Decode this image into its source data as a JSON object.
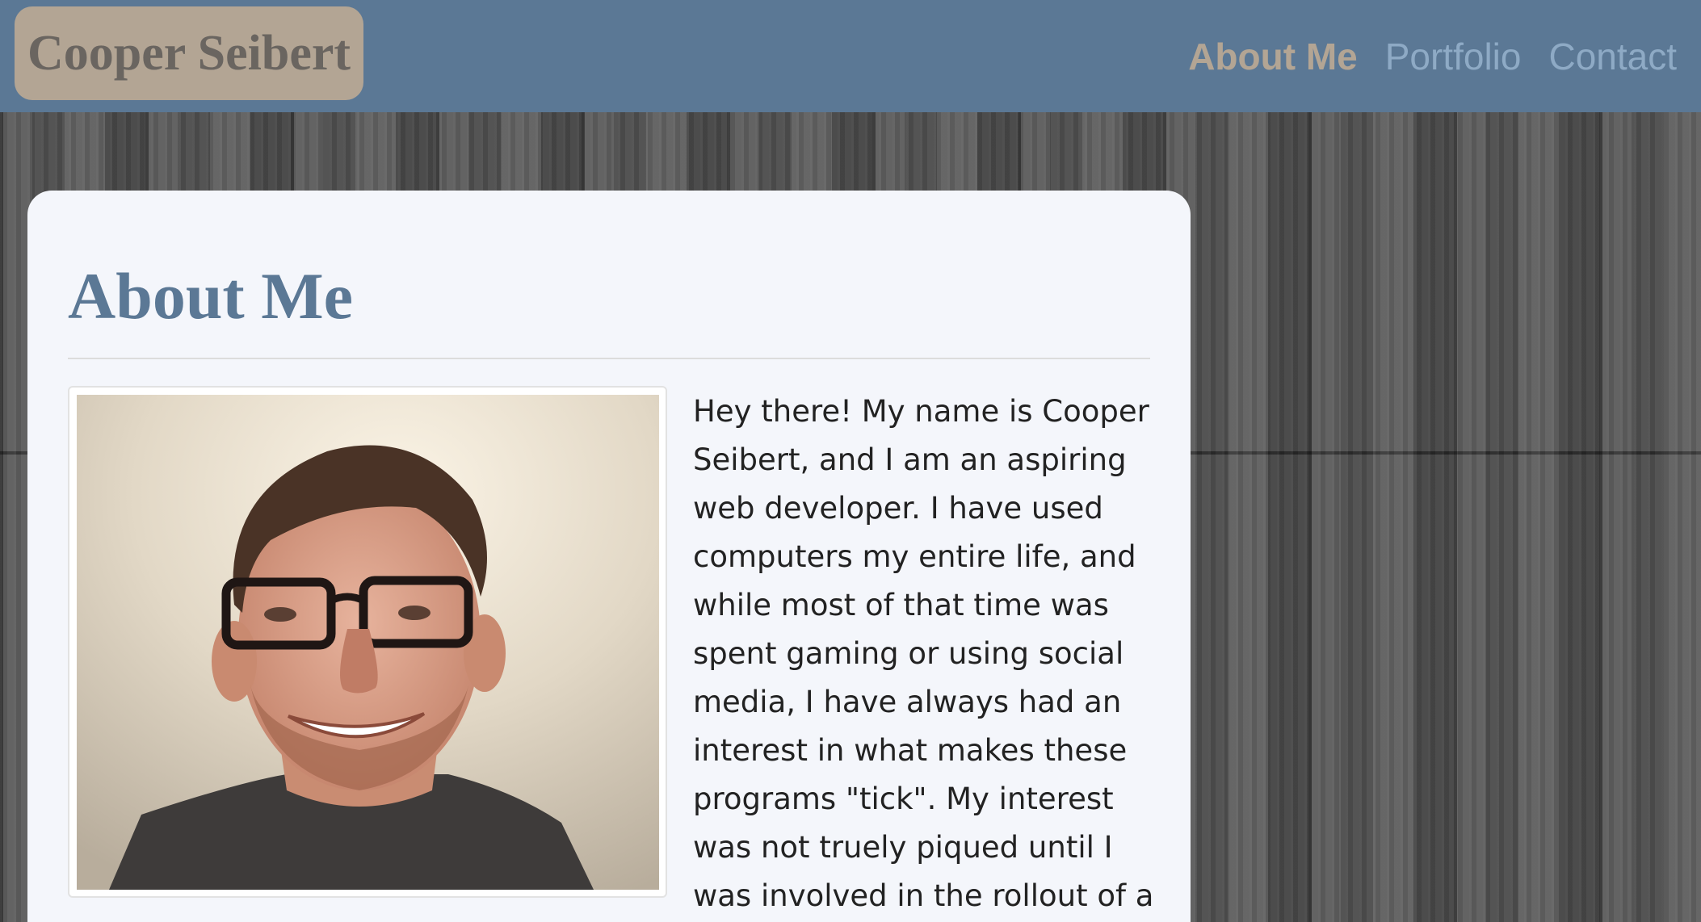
{
  "navbar": {
    "brand": "Cooper Seibert",
    "links": [
      {
        "label": "About Me",
        "active": true
      },
      {
        "label": "Portfolio",
        "active": false
      },
      {
        "label": "Contact",
        "active": false
      }
    ]
  },
  "main": {
    "title": "About Me",
    "bio": "Hey there! My name is Cooper Seibert, and I am an aspiring web developer. I have used computers my entire life, and while most of that time was spent gaming or using social media, I have always had an interest in what makes these programs \"tick\". My interest was not truely piqued until I was involved in the rollout of a"
  },
  "colors": {
    "navbar": "#5b7895",
    "brand_bg": "#b3a594",
    "nav_active": "#b3a594",
    "nav_inactive": "#8eaac5",
    "card_bg": "#f4f6fb",
    "heading": "#5b7895"
  }
}
